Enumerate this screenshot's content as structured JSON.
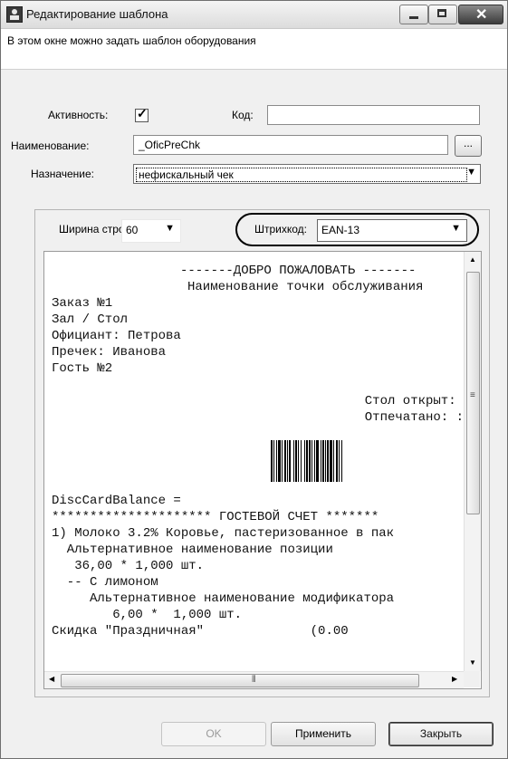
{
  "window": {
    "title": "Редактирование шаблона",
    "close_glyph": "✕"
  },
  "info": {
    "text": "В этом окне можно задать шаблон оборудования"
  },
  "form": {
    "active_label": "Активность:",
    "active_checked": true,
    "active_mark": "✓",
    "code_label": "Код:",
    "code_value": "",
    "name_label": "Наименование:",
    "name_value": "_OficPreChk",
    "browse_label": "...",
    "purpose_label": "Назначение:",
    "purpose_value": "нефискальный чек"
  },
  "template": {
    "width_label": "Ширина строки:",
    "width_value": "60",
    "barcode_label": "Штрихкод:",
    "barcode_value": "EAN-13"
  },
  "preview": {
    "lines": [
      "Заказ №1",
      "Зал / Стол",
      "Официант: Петрова",
      "Пречек: Иванова",
      "Гость №2"
    ],
    "header_lines": [
      "-------ДОБРО ПОЖАЛОВАТЬ -------",
      "Наименование точки обслуживания"
    ],
    "right_lines": [
      "Стол открыт: ",
      "Отпечатано: :"
    ],
    "bottom_lines": [
      "DiscCardBalance =",
      "********************* ГОСТЕВОЙ СЧЕТ *******",
      "1) Молоко 3.2% Коровье, пастеризованное в пак",
      "  Альтернативное наименование позиции",
      "   36,00 * 1,000 шт.",
      "  -- С лимоном",
      "     Альтернативное наименование модификатора",
      "        6,00 *  1,000 шт.",
      "Скидка \"Праздничная\"              (0.00"
    ],
    "barcode_bars": [
      2,
      1,
      1,
      2,
      1,
      1,
      3,
      1,
      1,
      2,
      2,
      1,
      1,
      1,
      2,
      3,
      1,
      1,
      2,
      1,
      1,
      2,
      1,
      3,
      1,
      1,
      2,
      1,
      2,
      1,
      1,
      2,
      1,
      1,
      3,
      2,
      1,
      1,
      2,
      1,
      1,
      1,
      2,
      1,
      3,
      1,
      1,
      2,
      2,
      1,
      1,
      2,
      1
    ]
  },
  "buttons": {
    "ok": "OK",
    "apply": "Применить",
    "close": "Закрыть"
  },
  "icons": {
    "dropdown": "▼",
    "scroll_up": "▲",
    "scroll_down": "▼",
    "scroll_left": "◀",
    "scroll_right": "▶",
    "grip_v": "≡",
    "grip_h": "⦀"
  }
}
